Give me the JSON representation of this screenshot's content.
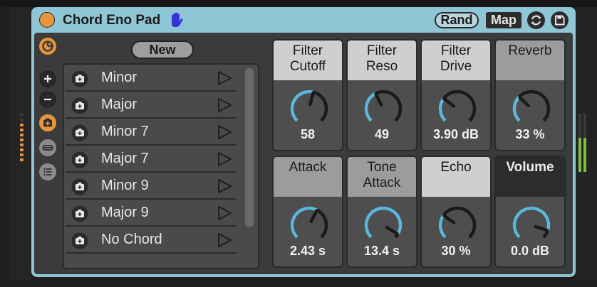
{
  "device": {
    "title": "Chord Eno Pad",
    "rand_label": "Rand",
    "map_label": "Map",
    "icons": {
      "status": "power-dot-icon",
      "hand": "hand-icon",
      "refresh": "refresh-icon",
      "save": "save-icon"
    },
    "accent": "#e8963d",
    "knob_color": "#5ab8dc"
  },
  "left_bar": {
    "buttons": [
      {
        "name": "chord-wheel-icon",
        "state": "active"
      },
      {
        "name": "add-icon",
        "state": "normal"
      },
      {
        "name": "remove-icon",
        "state": "normal"
      },
      {
        "name": "add-chord-icon",
        "state": "active"
      },
      {
        "name": "minus-icon",
        "state": "disabled"
      },
      {
        "name": "list-icon",
        "state": "disabled"
      }
    ]
  },
  "chord_list": {
    "new_label": "New",
    "items": [
      {
        "label": "Minor"
      },
      {
        "label": "Major"
      },
      {
        "label": "Minor 7"
      },
      {
        "label": "Major 7"
      },
      {
        "label": "Minor 9"
      },
      {
        "label": "Major 9"
      },
      {
        "label": "No Chord"
      }
    ]
  },
  "params": [
    {
      "line1": "Filter",
      "line2": "Cutoff",
      "value": "58",
      "style": "light",
      "knob": 0.55
    },
    {
      "line1": "Filter",
      "line2": "Reso",
      "value": "49",
      "style": "light",
      "knob": 0.4
    },
    {
      "line1": "Filter",
      "line2": "Drive",
      "value": "3.90 dB",
      "style": "light",
      "knob": 0.3
    },
    {
      "line1": "Reverb",
      "line2": "",
      "value": "33 %",
      "style": "gray",
      "knob": 0.33
    },
    {
      "line1": "Attack",
      "line2": "",
      "value": "2.43 s",
      "style": "gray",
      "knob": 0.6
    },
    {
      "line1": "Tone",
      "line2": "Attack",
      "value": "13.4 s",
      "style": "gray",
      "knob": 0.95
    },
    {
      "line1": "Echo",
      "line2": "",
      "value": "30 %",
      "style": "light",
      "knob": 0.3
    },
    {
      "line1": "Volume",
      "line2": "",
      "value": "0.0 dB",
      "style": "dark",
      "knob": 0.9
    }
  ]
}
